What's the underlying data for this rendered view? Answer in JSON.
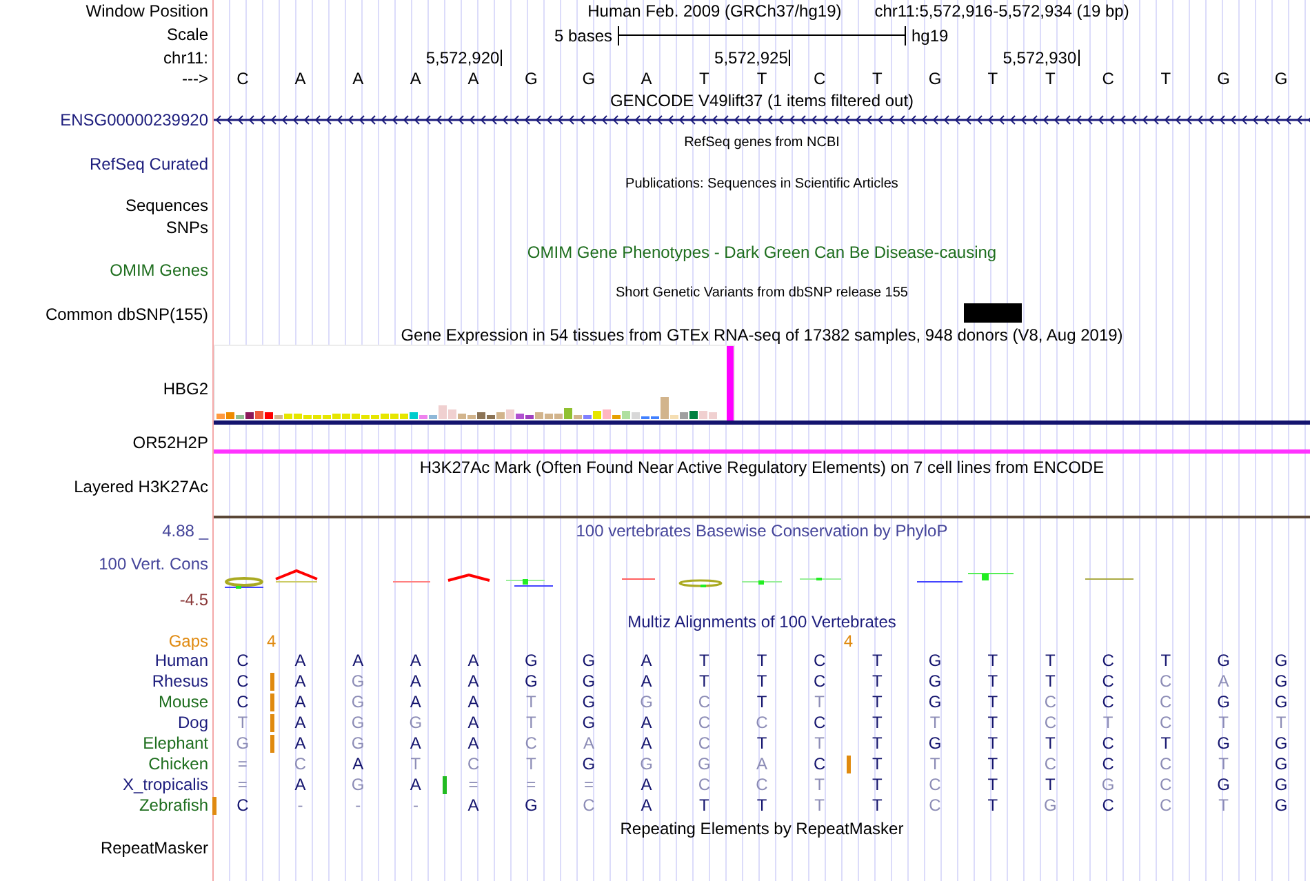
{
  "position": {
    "label": "Window Position",
    "assembly": "Human Feb. 2009 (GRCh37/hg19)",
    "range": "chr11:5,572,916-5,572,934 (19 bp)"
  },
  "scale": {
    "label": "Scale",
    "span": "5 bases",
    "db": "hg19"
  },
  "coordinates": {
    "label": "chr11:",
    "ticks": [
      "5,572,920",
      "5,572,925",
      "5,572,930"
    ]
  },
  "bases": {
    "label": "--->",
    "letters": [
      "C",
      "A",
      "A",
      "A",
      "A",
      "G",
      "G",
      "A",
      "T",
      "T",
      "C",
      "T",
      "G",
      "T",
      "T",
      "C",
      "T",
      "G",
      "G"
    ]
  },
  "tracks": [
    {
      "kind": "gene",
      "title": "GENCODE V49lift37 (1 items filtered out)",
      "labels": [
        {
          "text": "ENSG00000239920",
          "color": "#1c1c7c"
        }
      ]
    },
    {
      "kind": "compact",
      "title": "RefSeq genes from NCBI",
      "labels": [
        {
          "text": "RefSeq Curated",
          "color": "#1c1c7c"
        }
      ]
    },
    {
      "kind": "compact",
      "title": "Publications: Sequences in Scientific Articles",
      "labels": [
        {
          "text": "Sequences",
          "color": "#000000"
        },
        {
          "text": "SNPs",
          "color": "#000000"
        }
      ]
    },
    {
      "kind": "phenotype",
      "title": "OMIM Gene Phenotypes - Dark Green Can Be Disease-causing",
      "labels": [
        {
          "text": "OMIM Genes",
          "color": "#1e6e1e"
        }
      ]
    },
    {
      "kind": "snp",
      "title": "Short Genetic Variants from dbSNP release 155",
      "labels": [
        {
          "text": "Common dbSNP(155)",
          "color": "#000000"
        }
      ]
    },
    {
      "kind": "expression",
      "title": "Gene Expression in 54 tissues from GTEx RNA-seq of 17382 samples, 948 donors (V8, Aug 2019)",
      "labels": [
        {
          "text": "HBG2",
          "color": "#000000"
        },
        {
          "text": "OR52H2P",
          "color": "#000000"
        }
      ]
    },
    {
      "kind": "signal",
      "title": "H3K27Ac Mark (Often Found Near Active Regulatory Elements) on 7 cell lines from ENCODE",
      "labels": [
        {
          "text": "Layered H3K27Ac",
          "color": "#000000"
        }
      ]
    },
    {
      "kind": "conservation",
      "title": "100 vertebrates Basewise Conservation by PhyloP",
      "labels": [
        {
          "text": "4.88 _",
          "color": "#45459a"
        },
        {
          "text": "100 Vert. Cons",
          "color": "#45459a"
        },
        {
          "text": "-4.5",
          "color": "#8b3a3a"
        }
      ]
    },
    {
      "kind": "alignment",
      "title": "Multiz Alignments of 100 Vertebrates",
      "gaps": {
        "label": "Gaps",
        "color": "#e08a10",
        "cells": [
          {},
          {
            "count": "4"
          },
          {},
          {},
          {},
          {},
          {},
          {},
          {},
          {},
          {},
          {
            "count": "4"
          },
          {},
          {},
          {},
          {},
          {},
          {},
          {}
        ]
      },
      "species": [
        {
          "name": "Human",
          "color": "#1c1c7c",
          "bases": [
            {
              "base": "C",
              "insert": false
            },
            {
              "base": "A",
              "insert": false
            },
            {
              "base": "A",
              "insert": false
            },
            {
              "base": "A",
              "insert": false
            },
            {
              "base": "A",
              "insert": false
            },
            {
              "base": "G",
              "insert": false
            },
            {
              "base": "G",
              "insert": false
            },
            {
              "base": "A",
              "insert": false
            },
            {
              "base": "T",
              "insert": false
            },
            {
              "base": "T",
              "insert": false
            },
            {
              "base": "C",
              "insert": false
            },
            {
              "base": "T",
              "insert": false
            },
            {
              "base": "G",
              "insert": false
            },
            {
              "base": "T",
              "insert": false
            },
            {
              "base": "T",
              "insert": false
            },
            {
              "base": "C",
              "insert": false
            },
            {
              "base": "T",
              "insert": false
            },
            {
              "base": "G",
              "insert": false
            },
            {
              "base": "G",
              "insert": false
            }
          ]
        },
        {
          "name": "Rhesus",
          "color": "#1c1c7c",
          "bases": [
            {
              "base": "C",
              "insert": false
            },
            {
              "base": "A",
              "insert": true,
              "color": "#e08a10"
            },
            {
              "base": "G",
              "insert": false
            },
            {
              "base": "A",
              "insert": false
            },
            {
              "base": "A",
              "insert": false
            },
            {
              "base": "G",
              "insert": false
            },
            {
              "base": "G",
              "insert": false
            },
            {
              "base": "A",
              "insert": false
            },
            {
              "base": "T",
              "insert": false
            },
            {
              "base": "T",
              "insert": false
            },
            {
              "base": "C",
              "insert": false
            },
            {
              "base": "T",
              "insert": false
            },
            {
              "base": "G",
              "insert": false
            },
            {
              "base": "T",
              "insert": false
            },
            {
              "base": "T",
              "insert": false
            },
            {
              "base": "C",
              "insert": false
            },
            {
              "base": "C",
              "insert": false
            },
            {
              "base": "A",
              "insert": false
            },
            {
              "base": "G",
              "insert": false
            }
          ]
        },
        {
          "name": "Mouse",
          "color": "#1e6e1e",
          "bases": [
            {
              "base": "C",
              "insert": false
            },
            {
              "base": "A",
              "insert": true,
              "color": "#e08a10"
            },
            {
              "base": "G",
              "insert": false
            },
            {
              "base": "A",
              "insert": false
            },
            {
              "base": "A",
              "insert": false
            },
            {
              "base": "T",
              "insert": false
            },
            {
              "base": "G",
              "insert": false
            },
            {
              "base": "G",
              "insert": false
            },
            {
              "base": "C",
              "insert": false
            },
            {
              "base": "T",
              "insert": false
            },
            {
              "base": "T",
              "insert": false
            },
            {
              "base": "T",
              "insert": false
            },
            {
              "base": "G",
              "insert": false
            },
            {
              "base": "T",
              "insert": false
            },
            {
              "base": "C",
              "insert": false
            },
            {
              "base": "C",
              "insert": false
            },
            {
              "base": "C",
              "insert": false
            },
            {
              "base": "G",
              "insert": false
            },
            {
              "base": "G",
              "insert": false
            }
          ]
        },
        {
          "name": "Dog",
          "color": "#1c1c7c",
          "bases": [
            {
              "base": "T",
              "insert": false
            },
            {
              "base": "A",
              "insert": true,
              "color": "#e08a10"
            },
            {
              "base": "G",
              "insert": false
            },
            {
              "base": "G",
              "insert": false
            },
            {
              "base": "A",
              "insert": false
            },
            {
              "base": "T",
              "insert": false
            },
            {
              "base": "G",
              "insert": false
            },
            {
              "base": "A",
              "insert": false
            },
            {
              "base": "C",
              "insert": false
            },
            {
              "base": "C",
              "insert": false
            },
            {
              "base": "C",
              "insert": false
            },
            {
              "base": "T",
              "insert": false
            },
            {
              "base": "T",
              "insert": false
            },
            {
              "base": "T",
              "insert": false
            },
            {
              "base": "C",
              "insert": false
            },
            {
              "base": "T",
              "insert": false
            },
            {
              "base": "C",
              "insert": false
            },
            {
              "base": "T",
              "insert": false
            },
            {
              "base": "T",
              "insert": false
            }
          ]
        },
        {
          "name": "Elephant",
          "color": "#1e6e1e",
          "bases": [
            {
              "base": "G",
              "insert": false
            },
            {
              "base": "A",
              "insert": true,
              "color": "#e08a10"
            },
            {
              "base": "G",
              "insert": false
            },
            {
              "base": "A",
              "insert": false
            },
            {
              "base": "A",
              "insert": false
            },
            {
              "base": "C",
              "insert": false
            },
            {
              "base": "A",
              "insert": false
            },
            {
              "base": "A",
              "insert": false
            },
            {
              "base": "C",
              "insert": false
            },
            {
              "base": "T",
              "insert": false
            },
            {
              "base": "T",
              "insert": false
            },
            {
              "base": "T",
              "insert": false
            },
            {
              "base": "G",
              "insert": false
            },
            {
              "base": "T",
              "insert": false
            },
            {
              "base": "T",
              "insert": false
            },
            {
              "base": "C",
              "insert": false
            },
            {
              "base": "T",
              "insert": false
            },
            {
              "base": "G",
              "insert": false
            },
            {
              "base": "G",
              "insert": false
            }
          ]
        },
        {
          "name": "Chicken",
          "color": "#1e6e1e",
          "bases": [
            {
              "base": "=",
              "insert": false
            },
            {
              "base": "C",
              "insert": false
            },
            {
              "base": "A",
              "insert": false
            },
            {
              "base": "T",
              "insert": false
            },
            {
              "base": "C",
              "insert": false
            },
            {
              "base": "T",
              "insert": false
            },
            {
              "base": "G",
              "insert": false
            },
            {
              "base": "G",
              "insert": false
            },
            {
              "base": "G",
              "insert": false
            },
            {
              "base": "A",
              "insert": false
            },
            {
              "base": "C",
              "insert": false
            },
            {
              "base": "T",
              "insert": true,
              "color": "#e08a10"
            },
            {
              "base": "T",
              "insert": false
            },
            {
              "base": "T",
              "insert": false
            },
            {
              "base": "C",
              "insert": false
            },
            {
              "base": "C",
              "insert": false
            },
            {
              "base": "C",
              "insert": false
            },
            {
              "base": "T",
              "insert": false
            },
            {
              "base": "G",
              "insert": false
            }
          ]
        },
        {
          "name": "X_tropicalis",
          "color": "#1c1c7c",
          "bases": [
            {
              "base": "=",
              "insert": false
            },
            {
              "base": "A",
              "insert": false
            },
            {
              "base": "G",
              "insert": false
            },
            {
              "base": "A",
              "insert": false
            },
            {
              "base": "=",
              "insert": true,
              "color": "#22bb22"
            },
            {
              "base": "=",
              "insert": false
            },
            {
              "base": "=",
              "insert": false
            },
            {
              "base": "A",
              "insert": false
            },
            {
              "base": "C",
              "insert": false
            },
            {
              "base": "C",
              "insert": false
            },
            {
              "base": "T",
              "insert": false
            },
            {
              "base": "T",
              "insert": false
            },
            {
              "base": "C",
              "insert": false
            },
            {
              "base": "T",
              "insert": false
            },
            {
              "base": "T",
              "insert": false
            },
            {
              "base": "G",
              "insert": false
            },
            {
              "base": "C",
              "insert": false
            },
            {
              "base": "G",
              "insert": false
            },
            {
              "base": "G",
              "insert": false
            }
          ]
        },
        {
          "name": "Zebrafish",
          "color": "#1e6e1e",
          "bases": [
            {
              "base": "C",
              "insert": true,
              "color": "#e08a10"
            },
            {
              "base": "-",
              "insert": false
            },
            {
              "base": "-",
              "insert": false
            },
            {
              "base": "-",
              "insert": false
            },
            {
              "base": "A",
              "insert": false
            },
            {
              "base": "G",
              "insert": false
            },
            {
              "base": "C",
              "insert": false
            },
            {
              "base": "A",
              "insert": false
            },
            {
              "base": "T",
              "insert": false
            },
            {
              "base": "T",
              "insert": false
            },
            {
              "base": "T",
              "insert": false
            },
            {
              "base": "T",
              "insert": false
            },
            {
              "base": "C",
              "insert": false
            },
            {
              "base": "T",
              "insert": false
            },
            {
              "base": "G",
              "insert": false
            },
            {
              "base": "C",
              "insert": false
            },
            {
              "base": "C",
              "insert": false
            },
            {
              "base": "T",
              "insert": false
            },
            {
              "base": "G",
              "insert": false
            }
          ]
        }
      ]
    },
    {
      "kind": "plain",
      "title": "Repeating Elements by RepeatMasker",
      "labels": [
        {
          "text": "RepeatMasker",
          "color": "#000000"
        }
      ]
    }
  ]
}
